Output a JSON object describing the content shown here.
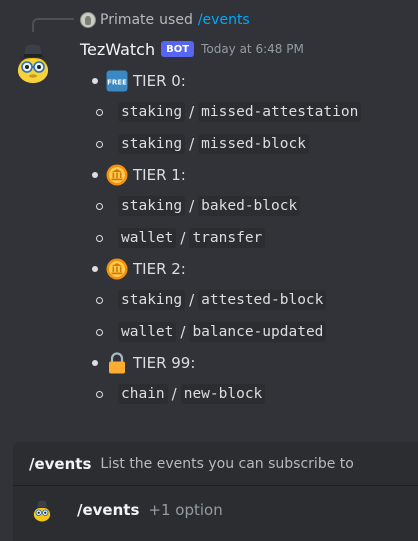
{
  "reply": {
    "user": "Primate",
    "used_text": "used",
    "command": "/events"
  },
  "message": {
    "bot_name": "TezWatch",
    "bot_tag": "BOT",
    "timestamp": "Today at 6:48 PM",
    "separator": "/",
    "tiers": [
      {
        "label": "TIER 0:",
        "icon": "free-icon",
        "icon_text": "FREE",
        "events": [
          {
            "category": "staking",
            "name": "missed-attestation"
          },
          {
            "category": "staking",
            "name": "missed-block"
          }
        ]
      },
      {
        "label": "TIER 1:",
        "icon": "coin-icon",
        "events": [
          {
            "category": "staking",
            "name": "baked-block"
          },
          {
            "category": "wallet",
            "name": "transfer"
          }
        ]
      },
      {
        "label": "TIER 2:",
        "icon": "coin-icon",
        "events": [
          {
            "category": "staking",
            "name": "attested-block"
          },
          {
            "category": "wallet",
            "name": "balance-updated"
          }
        ]
      },
      {
        "label": "TIER 99:",
        "icon": "lock-icon",
        "events": [
          {
            "category": "chain",
            "name": "new-block"
          }
        ]
      }
    ]
  },
  "command_panel": {
    "name": "/events",
    "description": "List the events you can subscribe to",
    "option_name": "/events",
    "option_extra": "+1 option"
  },
  "colors": {
    "background": "#313338",
    "panel": "#2b2d31",
    "link": "#00a8fc",
    "bot_tag": "#5865f2"
  }
}
